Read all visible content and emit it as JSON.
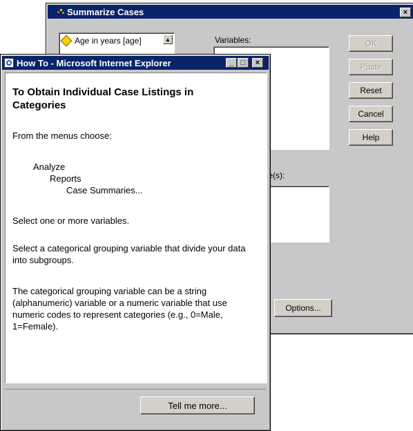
{
  "summarize_dialog": {
    "title": "Summarize Cases",
    "close_glyph": "×",
    "variable_list_item": "Age in years [age]",
    "variables_label": "Variables:",
    "grouping_label": "ble(s):",
    "buttons": {
      "ok": "OK",
      "paste": "Paste",
      "reset": "Reset",
      "cancel": "Cancel",
      "help": "Help",
      "options": "Options..."
    }
  },
  "help_window": {
    "title": "How To - Microsoft Internet Explorer",
    "heading": "To Obtain Individual Case Listings in Categories",
    "intro": "From the menus choose:",
    "menu_path": [
      "Analyze",
      "Reports",
      "Case Summaries..."
    ],
    "para1": "Select one or more variables.",
    "para2": "Select a categorical grouping variable that divide your data into subgroups.",
    "para3": "The categorical grouping variable can be a string (alphanumeric) variable or a numeric variable that use numeric codes to represent categories (e.g., 0=Male, 1=Female).",
    "tell_more_button": "Tell me more...",
    "window_controls": {
      "minimize": "_",
      "maximize": "□",
      "close": "×"
    }
  },
  "colors": {
    "titlebar": "#0a246a",
    "window_face": "#c8c8c8"
  }
}
